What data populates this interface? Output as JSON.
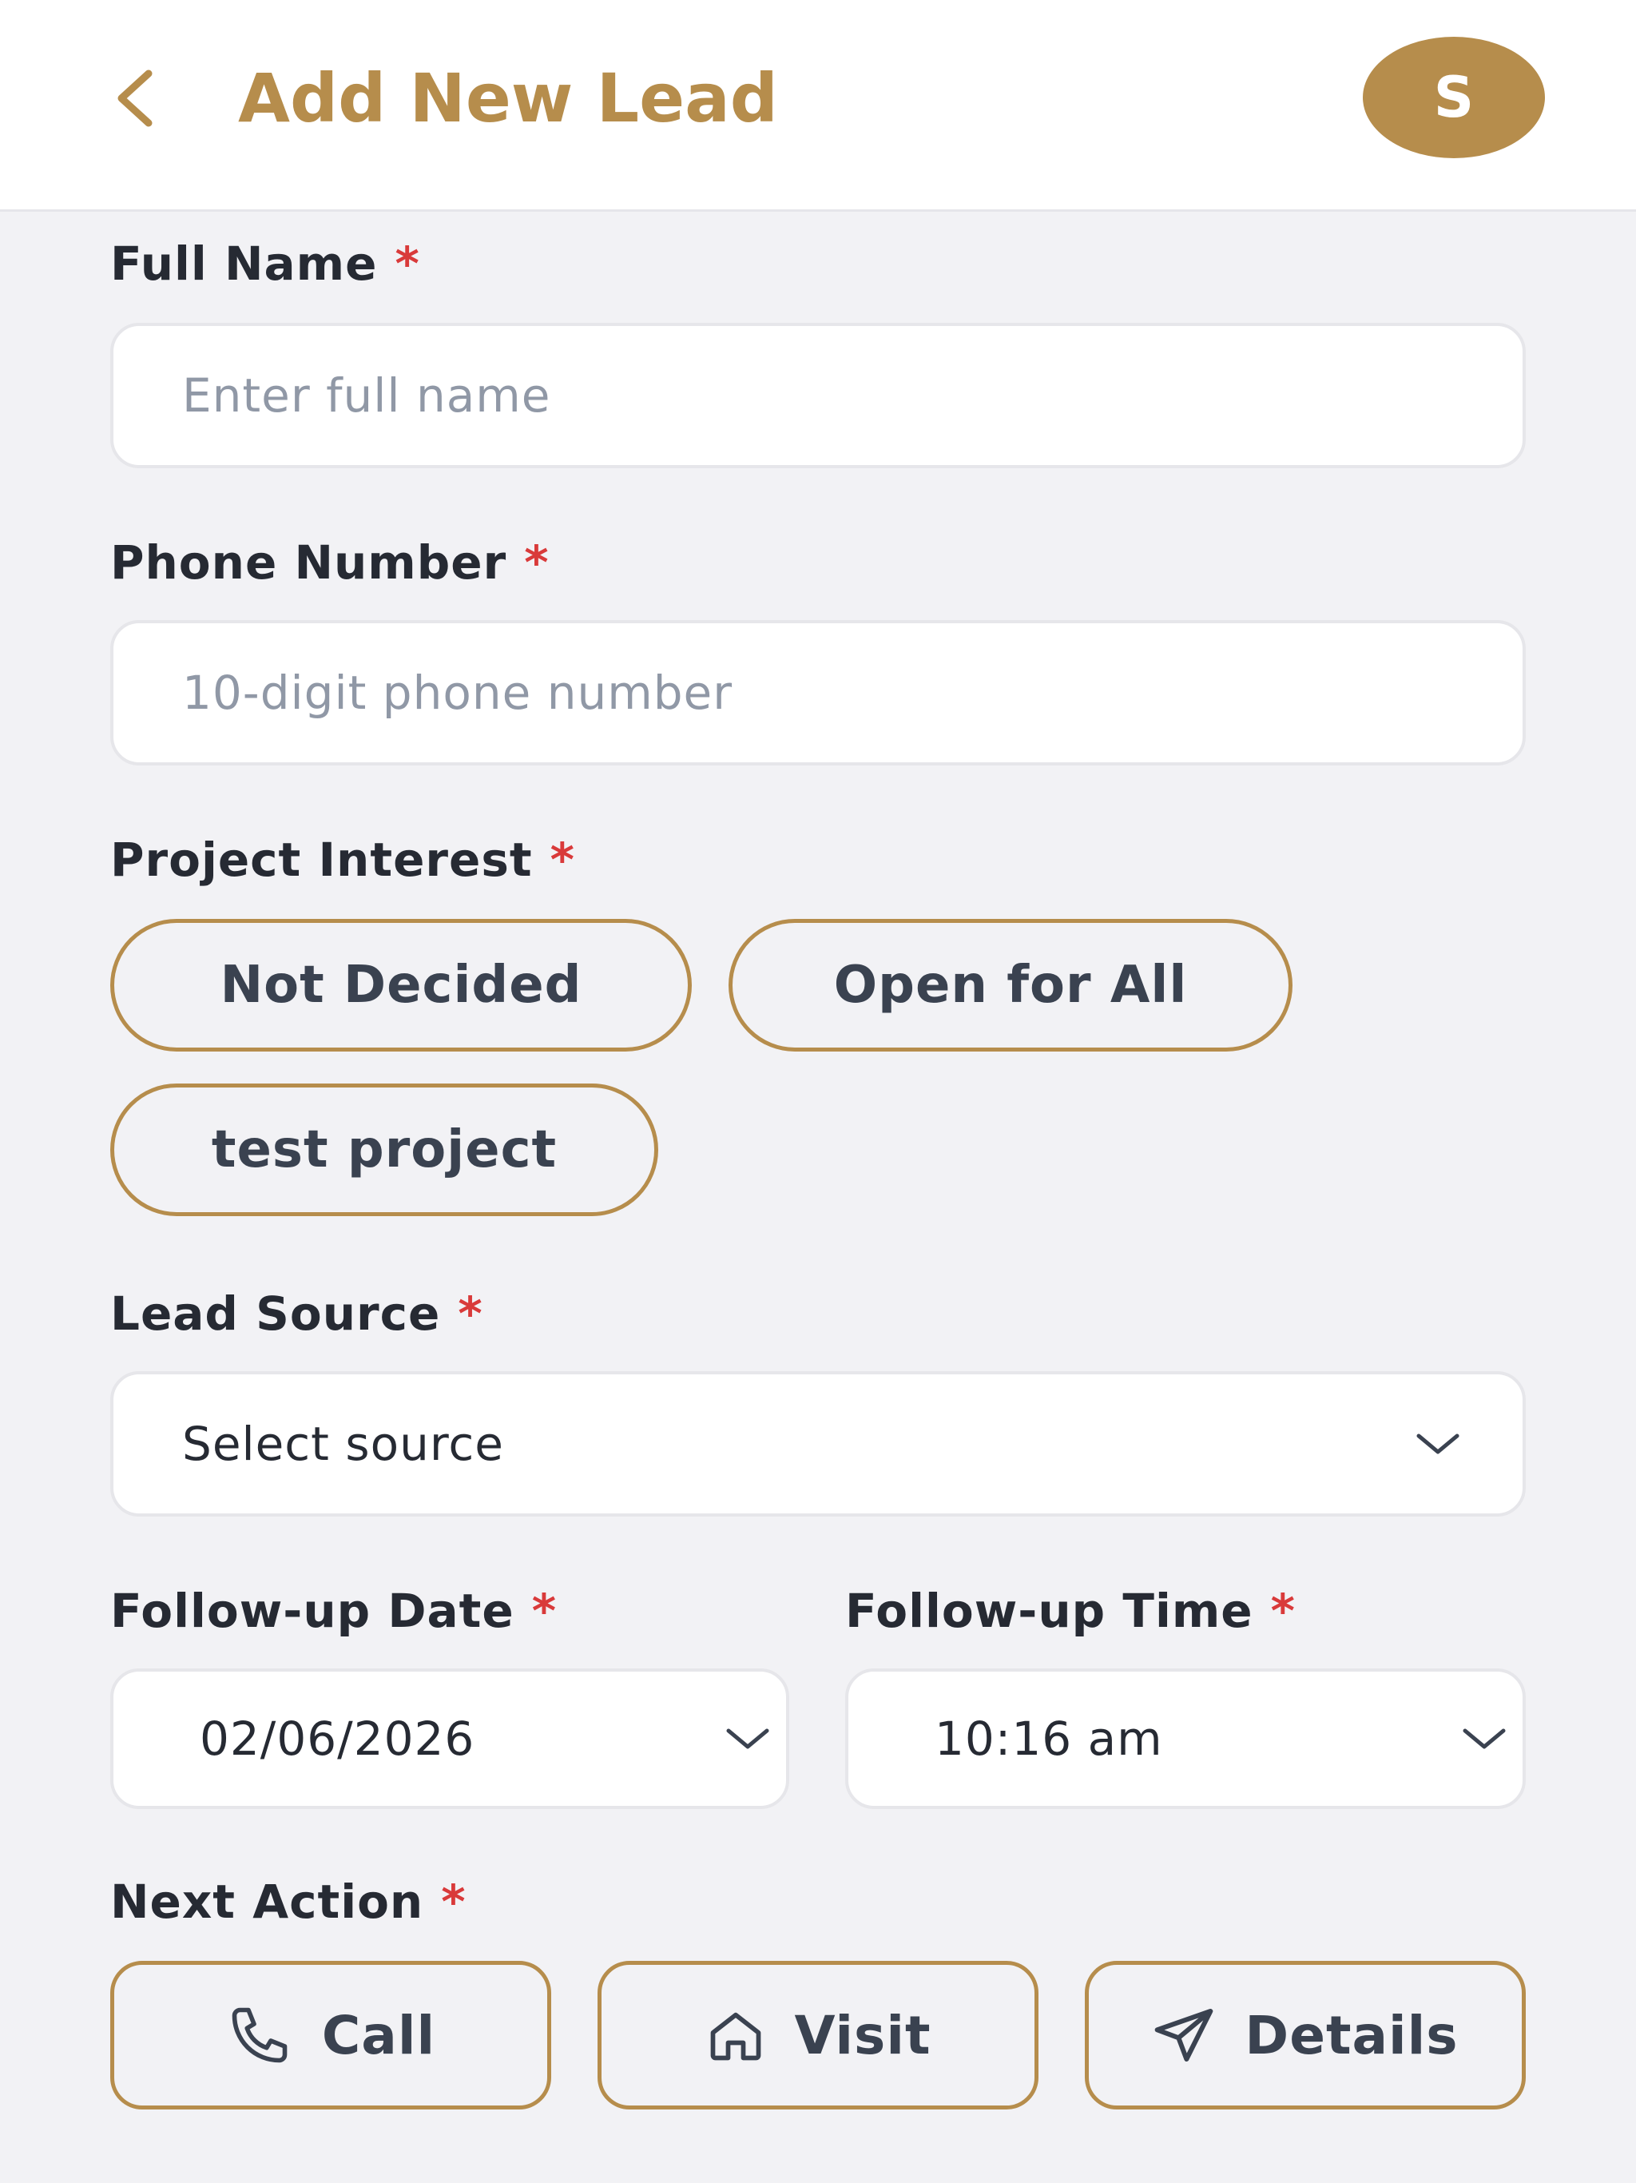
{
  "header": {
    "title": "Add New Lead",
    "avatar_initial": "S"
  },
  "colors": {
    "accent": "#b68d4c",
    "required": "#d93a3a",
    "background": "#f2f2f5"
  },
  "form": {
    "required_marker": "*",
    "full_name": {
      "label": "Full Name",
      "placeholder": "Enter full name",
      "value": ""
    },
    "phone": {
      "label": "Phone Number",
      "placeholder": "10-digit phone number",
      "value": ""
    },
    "project_interest": {
      "label": "Project Interest",
      "options": [
        "Not Decided",
        "Open for All",
        "test project"
      ]
    },
    "lead_source": {
      "label": "Lead Source",
      "selected": "Select source"
    },
    "followup_date": {
      "label": "Follow-up Date",
      "value": "02/06/2026"
    },
    "followup_time": {
      "label": "Follow-up Time",
      "value": "10:16 am"
    },
    "next_action": {
      "label": "Next Action",
      "options": [
        {
          "label": "Call",
          "icon": "phone-icon"
        },
        {
          "label": "Visit",
          "icon": "home-icon"
        },
        {
          "label": "Details",
          "icon": "send-icon"
        }
      ]
    }
  }
}
